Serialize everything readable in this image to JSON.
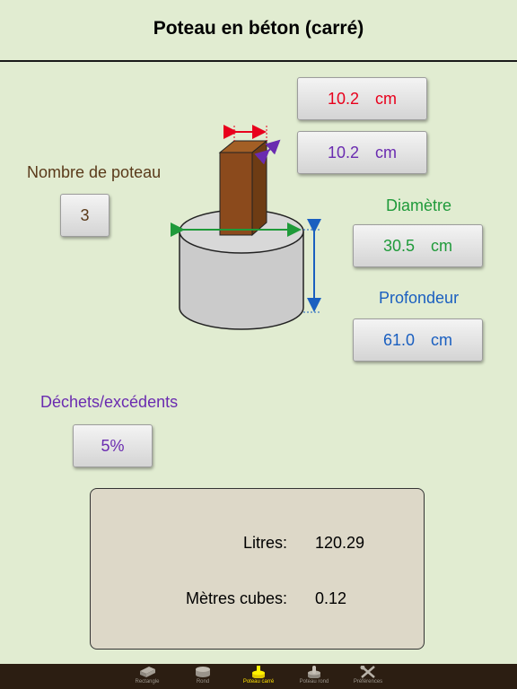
{
  "header": {
    "title": "Poteau en béton (carré)"
  },
  "post": {
    "width_value": "10.2",
    "width_unit": "cm",
    "width_color": "#e8001c",
    "depth_value": "10.2",
    "depth_unit": "cm",
    "depth_color": "#6a2bb0"
  },
  "count": {
    "label": "Nombre de poteau",
    "value": "3",
    "color": "#5a3a1a"
  },
  "diameter": {
    "label": "Diamètre",
    "value": "30.5",
    "unit": "cm",
    "color": "#1f9a3a"
  },
  "profondeur": {
    "label": "Profondeur",
    "value": "61.0",
    "unit": "cm",
    "color": "#1a5fc0"
  },
  "waste": {
    "label": "Déchets/excédents",
    "value": "5%",
    "color": "#6a2bb0"
  },
  "results": {
    "litres_label": "Litres:",
    "litres_value": "120.29",
    "m3_label": "Mètres cubes:",
    "m3_value": "0.12"
  },
  "tabs": [
    {
      "label": "Rectangle",
      "icon": "slab-icon",
      "active": false
    },
    {
      "label": "Rond",
      "icon": "cylinder-icon",
      "active": false
    },
    {
      "label": "Poteau carré",
      "icon": "square-post-icon",
      "active": true
    },
    {
      "label": "Poteau rond",
      "icon": "round-post-icon",
      "active": false
    },
    {
      "label": "Préférences",
      "icon": "tools-icon",
      "active": false
    }
  ]
}
